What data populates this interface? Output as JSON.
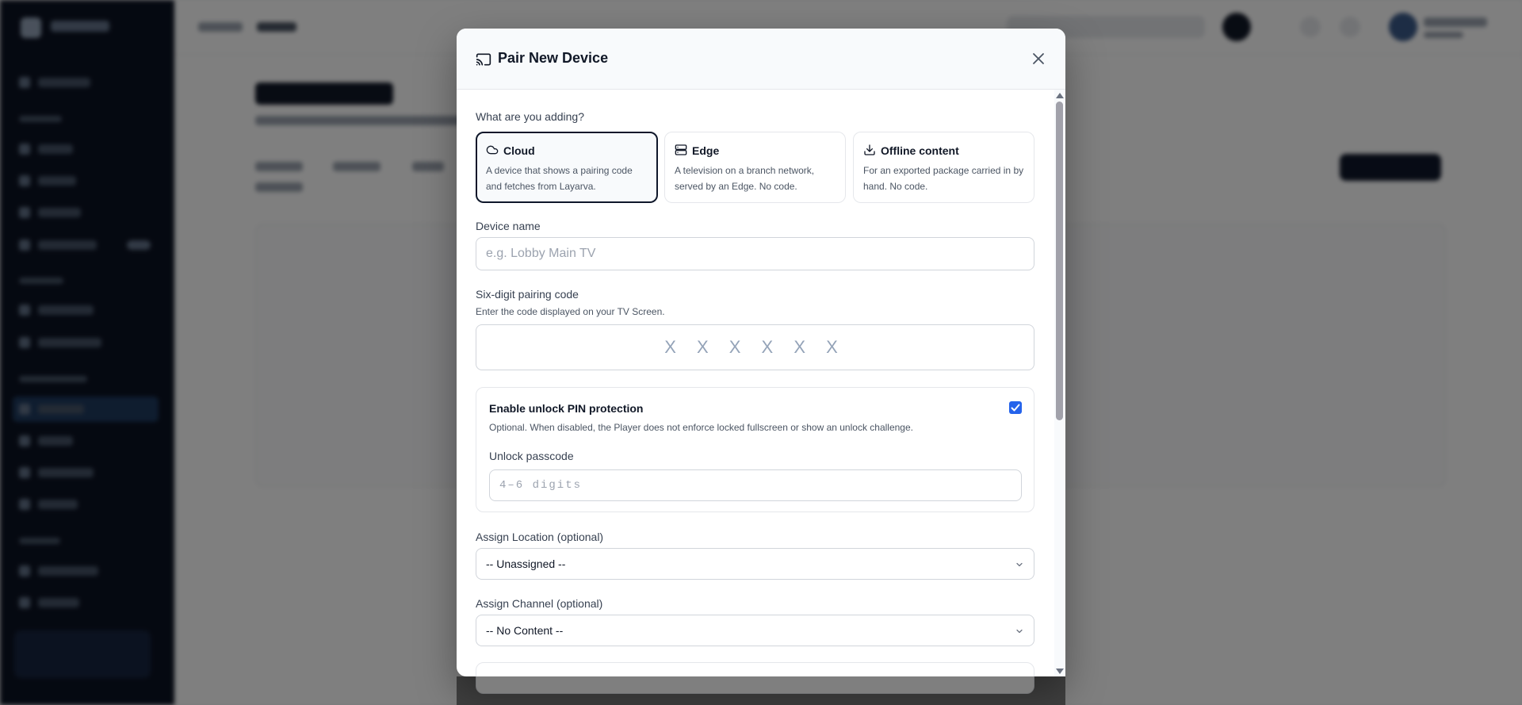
{
  "modal": {
    "title": "Pair New Device",
    "close_icon": "close-icon",
    "title_icon": "cast-icon"
  },
  "device_type": {
    "question": "What are you adding?",
    "options": [
      {
        "title": "Cloud",
        "icon": "cloud-icon",
        "description": "A device that shows a pairing code and fetches from Layarva.",
        "selected": true
      },
      {
        "title": "Edge",
        "icon": "server-icon",
        "description": "A television on a branch network, served by an Edge. No code.",
        "selected": false
      },
      {
        "title": "Offline content",
        "icon": "download-icon",
        "description": "For an exported package carried in by hand. No code.",
        "selected": false
      }
    ]
  },
  "device_name": {
    "label": "Device name",
    "placeholder": "e.g. Lobby Main TV",
    "value": ""
  },
  "pairing_code": {
    "label": "Six-digit pairing code",
    "hint": "Enter the code displayed on your TV Screen.",
    "placeholder": "X X X X X X",
    "value": ""
  },
  "pin_protection": {
    "title": "Enable unlock PIN protection",
    "description": "Optional. When disabled, the Player does not enforce locked fullscreen or show an unlock challenge.",
    "enabled": true,
    "passcode_label": "Unlock passcode",
    "passcode_placeholder": "4–6 digits"
  },
  "location": {
    "label": "Assign Location (optional)",
    "selected": "-- Unassigned --"
  },
  "channel": {
    "label": "Assign Channel (optional)",
    "selected": "-- No Content --"
  },
  "colors": {
    "accent": "#2563eb",
    "selected_border": "#0f172a",
    "overlay": "rgba(0,0,0,0.5)"
  }
}
